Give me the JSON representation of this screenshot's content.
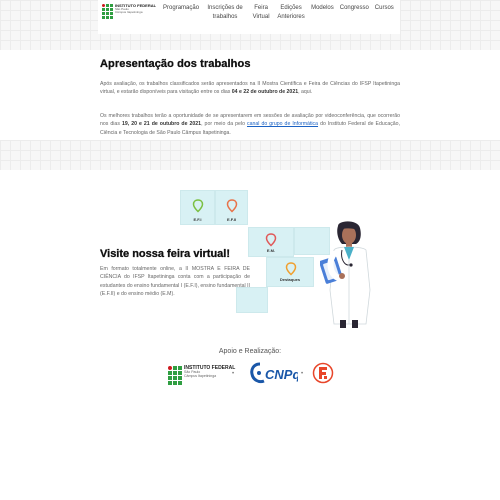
{
  "header": {
    "logo": {
      "line1": "INSTITUTO FEDERAL",
      "line2": "São Paulo",
      "line3": "Câmpus Itapetininga"
    },
    "nav": [
      {
        "label": "Programação"
      },
      {
        "label": "Inscrições de trabalhos"
      },
      {
        "label": "Feira Virtual"
      },
      {
        "label": "Edições Anteriores"
      },
      {
        "label": "Modelos"
      },
      {
        "label": "Congresso"
      },
      {
        "label": "Cursos"
      }
    ]
  },
  "presentation": {
    "title": "Apresentação dos trabalhos",
    "p1_before": "Após avaliação, os trabalhos classificados serão apresentados na II Mostra Científica e Feira de Ciências do IFSP Itapetininga virtual, e estarão disponíveis para visitação entre os dias ",
    "p1_bold": "04 e 22 de outubro de 2021",
    "p1_after": ", aqui.",
    "p2_before": "Os melhores trabalhos terão a oportunidade de se apresentarem em sessões de avaliação por videoconferência, que ocorrerão nos dias ",
    "p2_bold": "19, 20 e 21 de outubro de 2021",
    "p2_mid": ", por meio da pelo ",
    "p2_link": "canal do grupo de Informática",
    "p2_after": " do Instituto Federal de Educação, Ciência e Tecnologia de São Paulo Câmpus Itapetininga."
  },
  "virtual_fair": {
    "title": "Visite nossa feira virtual!",
    "text": "Em formato totalmente online, a II MOSTRA E FEIRA DE CIÊNCIA do IFSP Itapetininga conta com a participação de estudantes do ensino fundamental I (E.F.I), ensino fundamental II (E.F.II) e do ensino médio (E.M).",
    "cards": [
      {
        "label": "E.F.I",
        "pin_color": "#7bc043"
      },
      {
        "label": "E.F.II",
        "pin_color": "#e8734a"
      },
      {
        "label": "E.M.",
        "pin_color": "#e05a5a"
      },
      {
        "label": "Destaques",
        "pin_color": "#f0a030"
      }
    ]
  },
  "support": {
    "title": "Apoio e Realização:",
    "ifsp_line1": "INSTITUTO FEDERAL",
    "ifsp_line2": "São Paulo",
    "ifsp_line3": "Câmpus Itapetininga",
    "cnpq": "CNPq"
  },
  "colors": {
    "ifsp_green": "#2f9e41",
    "ifsp_red": "#cd191e",
    "card_bg": "#d8f1f4",
    "link": "#1b62c4",
    "cnpq_blue": "#1a57a8",
    "third_logo_red": "#e8462a"
  }
}
